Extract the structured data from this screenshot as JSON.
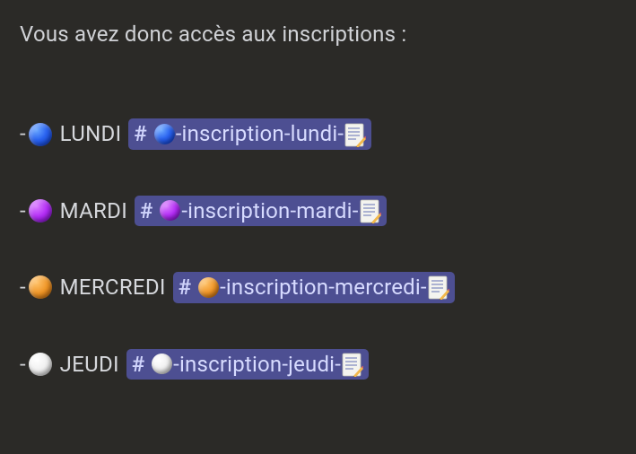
{
  "intro": "Vous avez donc accès aux inscriptions :",
  "dash": "-",
  "hash": "#",
  "days": [
    {
      "label": "LUNDI",
      "color": "blue",
      "chan_prefix": "-inscription-lundi-"
    },
    {
      "label": "MARDI",
      "color": "purple",
      "chan_prefix": "-inscription-mardi-"
    },
    {
      "label": "MERCREDI",
      "color": "orange",
      "chan_prefix": "-inscription-mercredi-"
    },
    {
      "label": "JEUDI",
      "color": "white",
      "chan_prefix": "-inscription-jeudi-"
    }
  ],
  "icons": {
    "circle_blue": "blue-circle-emoji",
    "circle_purple": "purple-circle-emoji",
    "circle_orange": "orange-circle-emoji",
    "circle_white": "white-circle-emoji",
    "memo": "memo-emoji"
  }
}
